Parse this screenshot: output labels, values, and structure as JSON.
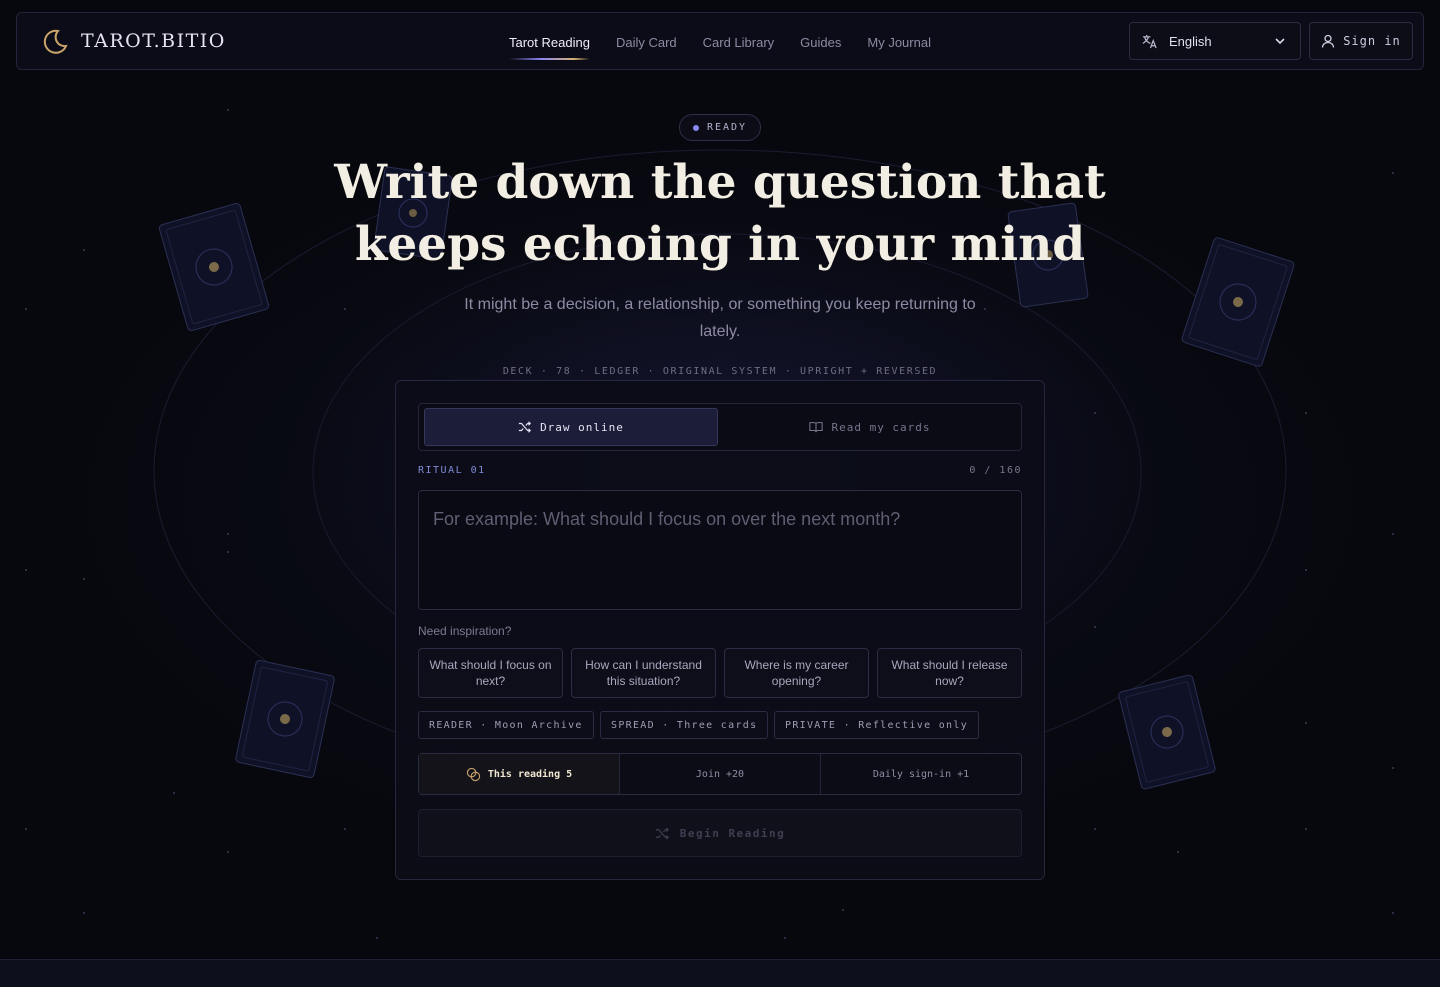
{
  "header": {
    "logo_text": "TAROT.BITIO",
    "nav": [
      {
        "label": "Tarot Reading",
        "active": true
      },
      {
        "label": "Daily Card",
        "active": false
      },
      {
        "label": "Card Library",
        "active": false
      },
      {
        "label": "Guides",
        "active": false
      },
      {
        "label": "My Journal",
        "active": false
      }
    ],
    "language": {
      "selected": "English"
    },
    "sign_in_label": "Sign in"
  },
  "hero": {
    "status_badge": "READY",
    "title": "Write down the question that keeps echoing in your mind",
    "subtitle": "It might be a decision, a relationship, or something you keep returning to lately.",
    "meta": "DECK · 78 · LEDGER · ORIGINAL SYSTEM · UPRIGHT + REVERSED"
  },
  "panel": {
    "tabs": [
      {
        "label": "Draw online",
        "icon": "shuffle-icon",
        "active": true
      },
      {
        "label": "Read my cards",
        "icon": "book-icon",
        "active": false
      }
    ],
    "ritual_label": "RITUAL 01",
    "char_count": "0 / 160",
    "question": {
      "value": "",
      "placeholder": "For example: What should I focus on over the next month?"
    },
    "inspiration_label": "Need inspiration?",
    "suggestions": [
      "What should I focus on next?",
      "How can I understand this situation?",
      "Where is my career opening?",
      "What should I release now?"
    ],
    "tags": [
      "READER · Moon Archive",
      "SPREAD · Three cards",
      "PRIVATE · Reflective only"
    ],
    "credits": {
      "this_reading": "This reading 5",
      "join": "Join +20",
      "daily": "Daily sign-in +1"
    },
    "begin_label": "Begin Reading"
  },
  "colors": {
    "background": "#07080e",
    "accent_violet": "#8b86f0",
    "accent_gold": "#c9a46a",
    "title_ivory": "#f3eee3"
  }
}
